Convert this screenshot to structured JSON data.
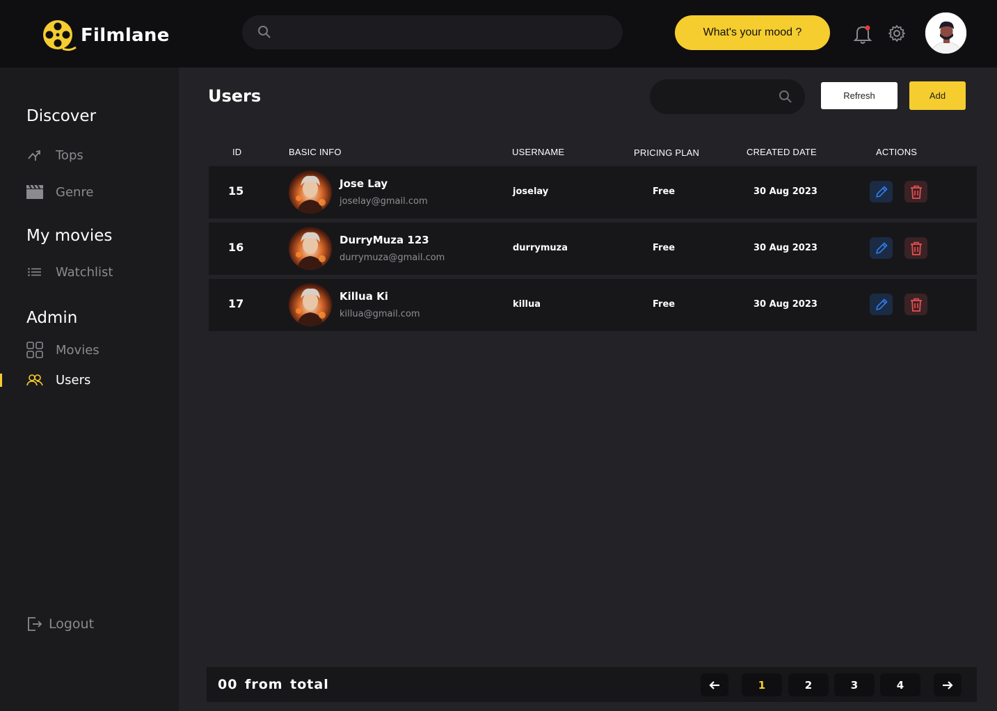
{
  "brand": {
    "name": "Filmlane",
    "accent": "#f5cd2f"
  },
  "header": {
    "search_placeholder": "",
    "mood_button": "What's your mood ?"
  },
  "sidebar": {
    "sections": [
      {
        "title": "Discover",
        "items": [
          {
            "label": "Tops",
            "icon": "trending-icon"
          },
          {
            "label": "Genre",
            "icon": "clapperboard-icon"
          }
        ]
      },
      {
        "title": "My movies",
        "items": [
          {
            "label": "Watchlist",
            "icon": "list-icon"
          }
        ]
      },
      {
        "title": "Admin",
        "items": [
          {
            "label": "Movies",
            "icon": "grid-icon"
          },
          {
            "label": "Users",
            "icon": "users-icon",
            "active": true
          }
        ]
      }
    ],
    "logout": "Logout"
  },
  "main": {
    "title": "Users",
    "refresh_label": "Refresh",
    "add_label": "Add",
    "columns": [
      "ID",
      "BASIC INFO",
      "USERNAME",
      "PRICING PLAN",
      "CREATED DATE",
      "ACTIONS"
    ],
    "rows": [
      {
        "id": "15",
        "name": "Jose Lay",
        "email": "joselay@gmail.com",
        "username": "joselay",
        "plan": "Free",
        "created": "30 Aug 2023"
      },
      {
        "id": "16",
        "name": "DurryMuza 123",
        "email": "durrymuza@gmail.com",
        "username": "durrymuza",
        "plan": "Free",
        "created": "30 Aug 2023"
      },
      {
        "id": "17",
        "name": "Killua Ki",
        "email": "killua@gmail.com",
        "username": "killua",
        "plan": "Free",
        "created": "30 Aug 2023"
      }
    ]
  },
  "footer": {
    "summary": "00 from total",
    "pages": [
      "1",
      "2",
      "3",
      "4"
    ],
    "current_page": "1"
  }
}
